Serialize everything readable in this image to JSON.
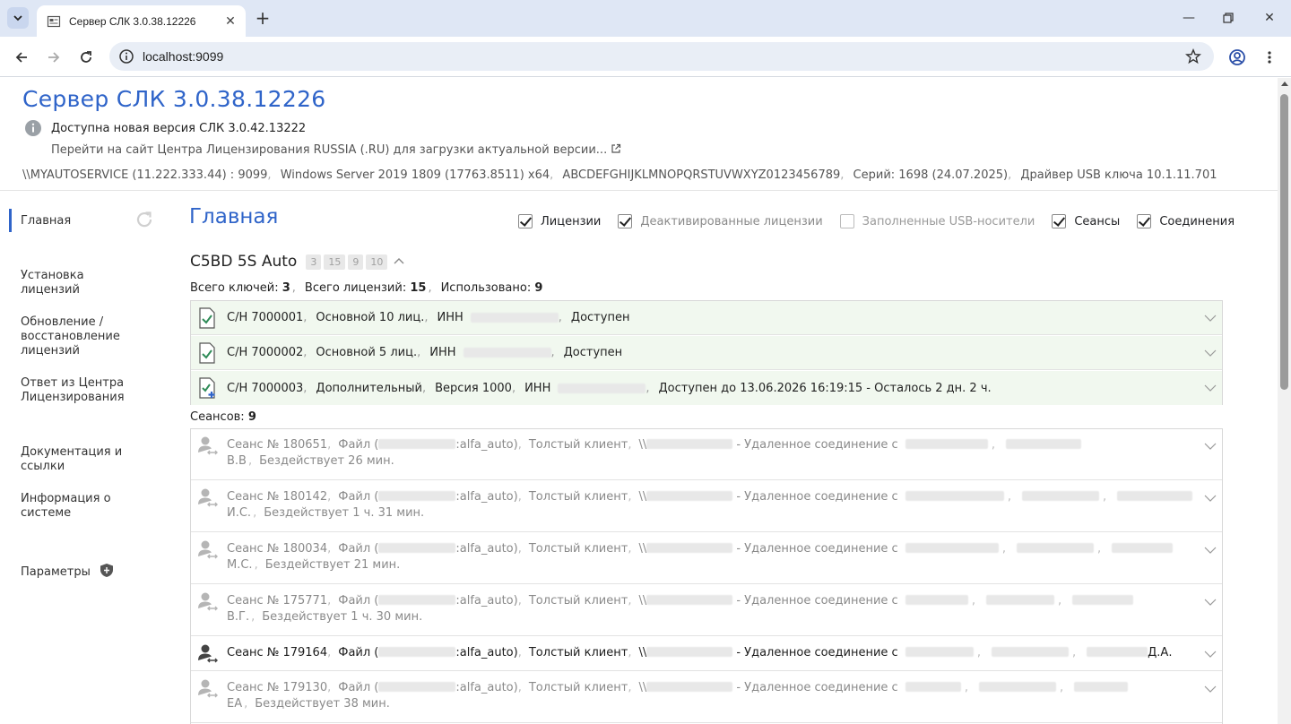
{
  "browser": {
    "tab_title": "Сервер СЛК 3.0.38.12226",
    "url": "localhost:9099"
  },
  "header": {
    "title": "Сервер СЛК 3.0.38.12226",
    "update_notice": "Доступна новая версия СЛК 3.0.42.13222",
    "update_link": "Перейти на сайт Центра Лицензирования RUSSIA (.RU) для загрузки актуальной версии...",
    "sysinfo": [
      "\\\\MYAUTOSERVICE (11.222.333.44) : 9099",
      "Windows Server 2019 1809 (17763.8511) x64",
      "ABCDEFGHIJKLMNOPQRSTUVWXYZ0123456789",
      "Серий: 1698 (24.07.2025)",
      "Драйвер USB ключа 10.1.11.701"
    ]
  },
  "sidebar": {
    "items": [
      {
        "label": "Главная"
      },
      {
        "label": "Установка лицензий"
      },
      {
        "label": "Обновление / восстановление лицензий"
      },
      {
        "label": "Ответ из Центра Лицензирования"
      },
      {
        "label": "Документация и ссылки"
      },
      {
        "label": "Информация о системе"
      },
      {
        "label": "Параметры"
      }
    ]
  },
  "main": {
    "title": "Главная",
    "filters": [
      {
        "label": "Лицензии",
        "checked": true
      },
      {
        "label": "Деактивированные лицензии",
        "checked": true
      },
      {
        "label": "Заполненные USB-носители",
        "checked": false
      },
      {
        "label": "Сеансы",
        "checked": true
      },
      {
        "label": "Соединения",
        "checked": true
      }
    ],
    "product": {
      "name": "C5BD 5S Auto",
      "badges": [
        "3",
        "15",
        "9",
        "10"
      ]
    },
    "totals": {
      "keys_label": "Всего ключей:",
      "keys": "3",
      "licenses_label": "Всего лицензий:",
      "licenses": "15",
      "used_label": "Использовано:",
      "used": "9"
    },
    "licenses": [
      {
        "serial": "С/Н 7000001",
        "type": "Основной 10 лиц.",
        "inn": "ИНН",
        "status": "Доступен"
      },
      {
        "serial": "С/Н 7000002",
        "type": "Основной 5 лиц.",
        "inn": "ИНН",
        "status": "Доступен"
      },
      {
        "serial": "С/Н 7000003",
        "type": "Дополнительный",
        "version": "Версия 1000",
        "inn": "ИНН",
        "status": "Доступен до 13.06.2026 16:19:15 - Осталось 2 дн. 2 ч."
      }
    ],
    "sessions_label": "Сеансов:",
    "sessions_count": "9",
    "sessions": [
      {
        "id": "Сеанс № 180651",
        "file_prefix": "Файл (",
        "file_suffix": ":alfa_auto)",
        "client": "Толстый клиент",
        "host_prefix": "\\\\",
        "remote": "- Удаленное соединение с",
        "user": "В.В",
        "idle": "Бездействует 26 мин.",
        "active": false
      },
      {
        "id": "Сеанс № 180142",
        "file_prefix": "Файл (",
        "file_suffix": ":alfa_auto)",
        "client": "Толстый клиент",
        "host_prefix": "\\\\",
        "remote": "- Удаленное соединение с",
        "user": "И.С.",
        "idle": "Бездействует 1 ч. 31 мин.",
        "active": false
      },
      {
        "id": "Сеанс № 180034",
        "file_prefix": "Файл (",
        "file_suffix": ":alfa_auto)",
        "client": "Толстый клиент",
        "host_prefix": "\\\\",
        "remote": "- Удаленное соединение с",
        "user": "М.С.",
        "idle": "Бездействует 21 мин.",
        "active": false
      },
      {
        "id": "Сеанс № 175771",
        "file_prefix": "Файл (",
        "file_suffix": ":alfa_auto)",
        "client": "Толстый клиент",
        "host_prefix": "\\\\",
        "remote": "- Удаленное соединение с",
        "user": "В.Г.",
        "idle": "Бездействует 1 ч. 30 мин.",
        "active": false
      },
      {
        "id": "Сеанс № 179164",
        "file_prefix": "Файл (",
        "file_suffix": ":alfa_auto)",
        "client": "Толстый клиент",
        "host_prefix": "\\\\",
        "remote": "- Удаленное соединение с",
        "user": "Д.А.",
        "idle": "",
        "active": true
      },
      {
        "id": "Сеанс № 179130",
        "file_prefix": "Файл (",
        "file_suffix": ":alfa_auto)",
        "client": "Толстый клиент",
        "host_prefix": "\\\\",
        "remote": "- Удаленное соединение с",
        "user": "ЕА",
        "idle": "Бездействует 38 мин.",
        "active": false
      }
    ]
  },
  "colors": {
    "accent": "#2f64c9",
    "license_row_bg": "#f1f8ef",
    "license_check": "#2e8b57"
  }
}
